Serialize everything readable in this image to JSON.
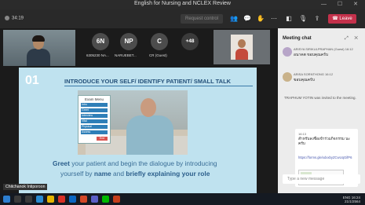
{
  "window": {
    "title": "English for Nursing and NCLEX Review"
  },
  "meeting_bar": {
    "timer": "34:19",
    "request_control": "Request control",
    "leave": "Leave"
  },
  "participants": [
    {
      "initials": "6N",
      "label": "6305230 NA...",
      "color": "#4a4a4a"
    },
    {
      "initials": "NP",
      "label": "NARUEBET...",
      "color": "#4a4a4a"
    },
    {
      "initials": "C",
      "label": "CR (Guest)",
      "color": "#4a4a4a"
    },
    {
      "initials": "+48",
      "label": "",
      "color": "#3b3b3b"
    }
  ],
  "presenter_name": "Chitchanok Intiporoon",
  "slide": {
    "number": "01",
    "heading": "INTRODUCE YOUR SELF/ IDENTIFY PATIENT/ SMALL TALK",
    "exam_menu_title": "Exam Menu",
    "exam_menu_items": [
      "Intro",
      "Greet",
      "Interview",
      "Vital",
      "Physical",
      "Assess"
    ],
    "exam_menu_end": "End Exam",
    "line1_a": "Greet",
    "line1_b": " your patient and begin the dialogue by introducing",
    "line2_a": "yourself by ",
    "line2_b": "name",
    "line2_c": " and ",
    "line2_d": "briefly explaining your role"
  },
  "chat": {
    "header": "Meeting chat",
    "messages": [
      {
        "name": "ARISYA SIRIKULPRAPHAN (Guest)",
        "time": "16:12",
        "text": "อนาคต ขอบคุณครับ"
      },
      {
        "name": "ARISA SORNTHONG",
        "time": "16:12",
        "text": "ขอบคุณครับ"
      }
    ],
    "system": "TRAPHUM YOTIN was invited to the meeting.",
    "bubble": {
      "time": "16:13",
      "text": "สำหรับลงชื่อเข้าร่วมกิจกรรม นะครับ",
      "link": "https://forms.gle/xdxxbyZCwUqGifP6",
      "card_label": "forms.gle"
    },
    "compose_placeholder": "Type a new message"
  },
  "taskbar": {
    "time": "16:24",
    "date": "21/1/2564",
    "lang": "ENG"
  }
}
